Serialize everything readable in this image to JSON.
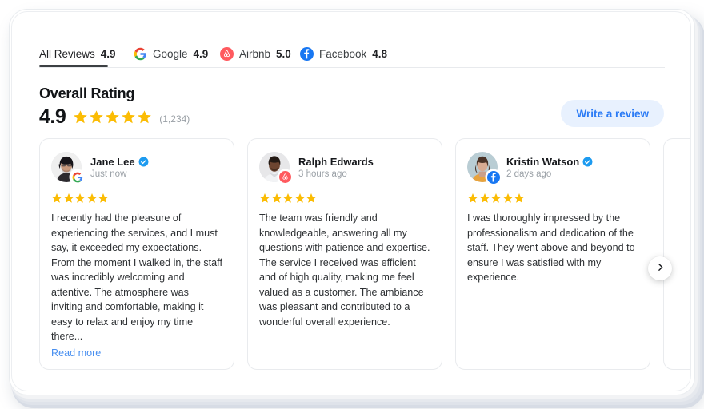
{
  "tabs": [
    {
      "name": "All Reviews",
      "score": "4.9",
      "icon": "none",
      "active": true
    },
    {
      "name": "Google",
      "score": "4.9",
      "icon": "google-icon",
      "active": false
    },
    {
      "name": "Airbnb",
      "score": "5.0",
      "icon": "airbnb-icon",
      "active": false
    },
    {
      "name": "Facebook",
      "score": "4.8",
      "icon": "facebook-icon",
      "active": false
    }
  ],
  "header": {
    "title": "Overall Rating",
    "rating": "4.9",
    "stars": 5,
    "count": "(1,234)",
    "write_review_label": "Write a review"
  },
  "colors": {
    "star": "#FBBC04",
    "link": "#4a90f0",
    "button_text": "#2b7bf5",
    "button_bg": "#e8f1fe",
    "verified": "#1d9bf0",
    "google_blue": "#4285F4",
    "airbnb_red": "#FF5A5F",
    "facebook_blue": "#1877F2"
  },
  "reviews": [
    {
      "name": "Jane Lee",
      "verified": true,
      "time": "Just now",
      "source": "google-icon",
      "stars": 5,
      "text": "I recently had the pleasure of experiencing the services, and I must say, it exceeded my expectations. From the moment I walked in, the staff was incredibly welcoming and attentive. The atmosphere was inviting and comfortable, making it easy to relax and enjoy my time there...",
      "read_more": "Read more"
    },
    {
      "name": "Ralph Edwards",
      "verified": false,
      "time": "3 hours ago",
      "source": "airbnb-icon",
      "stars": 5,
      "text": "The team was friendly and knowledgeable, answering all my questions with patience and expertise. The service I received was efficient and of high quality, making me feel valued as a customer. The ambiance was pleasant and contributed to a wonderful overall experience.",
      "read_more": ""
    },
    {
      "name": "Kristin Watson",
      "verified": true,
      "time": "2 days ago",
      "source": "facebook-icon",
      "stars": 5,
      "text": "I was thoroughly impressed by the professionalism and dedication of the staff. They went above and beyond to ensure I was satisfied with my experience.",
      "read_more": ""
    }
  ],
  "carousel": {
    "next_label": "›"
  }
}
